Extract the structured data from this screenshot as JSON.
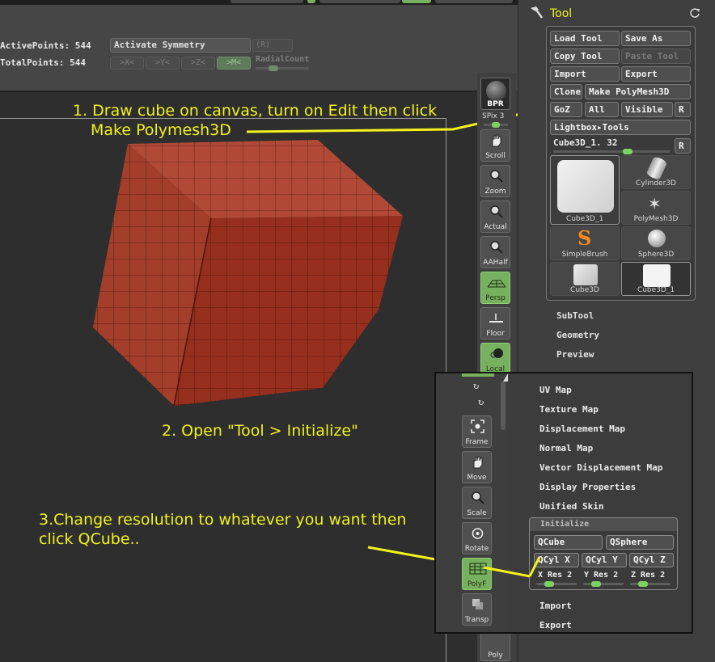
{
  "topbar": {
    "active_points_label": "ActivePoints: 544",
    "total_points_label": "TotalPoints: 544",
    "activate_symmetry": "Activate Symmetry",
    "sym_r": "(R)",
    "sym_x": ">X<",
    "sym_y": ">Y<",
    "sym_z": ">Z<",
    "sym_m": ">M<",
    "radial_count": "RadialCount"
  },
  "annotations": {
    "step1_line1": "1. Draw cube on canvas, turn on Edit then click",
    "step1_line2": "Make Polymesh3D",
    "step2": "2. Open \"Tool > Initialize\"",
    "step3_line1": "3.Change resolution to whatever you want then",
    "step3_line2": "click QCube..",
    "arrow_color": "#f2f21d"
  },
  "shelf": {
    "bpr": "BPR",
    "spix": "SPix 3",
    "scroll": "Scroll",
    "zoom": "Zoom",
    "actual": "Actual",
    "aahalf": "AAHalf",
    "persp": "Persp",
    "floor": "Floor",
    "local": "Local",
    "frame": "Frame",
    "move": "Move",
    "scale": "Scale",
    "rotate": "Rotate",
    "polyf": "PolyF",
    "transp": "Transp",
    "poly": "Poly"
  },
  "tool_panel": {
    "title": "Tool",
    "load_tool": "Load Tool",
    "save_as": "Save As",
    "copy_tool": "Copy Tool",
    "paste_tool": "Paste Tool",
    "import": "Import",
    "export": "Export",
    "clone": "Clone",
    "make_polymesh": "Make PolyMesh3D",
    "goz": "GoZ",
    "all": "All",
    "visible": "Visible",
    "r": "R",
    "lightbox_tools": "Lightbox▸Tools",
    "current_tool": "Cube3D_1. 32",
    "tiles": {
      "cube3d_1": "Cube3D_1",
      "cylinder3d": "Cylinder3D",
      "polymesh3d": "PolyMesh3D",
      "simplebrush": "SimpleBrush",
      "sphere3d": "Sphere3D",
      "cube3d": "Cube3D",
      "cube3d_1b": "Cube3D_1"
    },
    "subtool": "SubTool",
    "geometry": "Geometry",
    "preview": "Preview"
  },
  "popup": {
    "uv_map": "UV Map",
    "texture_map": "Texture Map",
    "displacement_map": "Displacement Map",
    "normal_map": "Normal Map",
    "vector_displacement_map": "Vector Displacement Map",
    "display_properties": "Display Properties",
    "unified_skin": "Unified Skin",
    "initialize": {
      "title": "Initialize",
      "qcube": "QCube",
      "qsphere": "QSphere",
      "qcyl_x": "QCyl X",
      "qcyl_y": "QCyl Y",
      "qcyl_z": "QCyl Z",
      "x_res": "X Res 2",
      "y_res": "Y Res 2",
      "z_res": "Z Res 2"
    },
    "import": "Import",
    "export": "Export"
  }
}
